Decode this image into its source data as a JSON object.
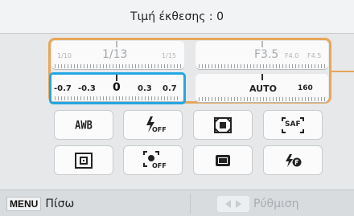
{
  "header": {
    "title": "Τιμή έκθεσης : 0"
  },
  "shutter": {
    "values": [
      "1/10",
      "1/13",
      "1/15"
    ]
  },
  "aperture": {
    "values": [
      "F3.5",
      "F4.0",
      "F4.5"
    ]
  },
  "exposure_compensation": {
    "values": [
      "-0.7",
      "-0.3",
      "0",
      "0.3",
      "0.7"
    ],
    "selected": "0"
  },
  "iso": {
    "values": [
      "AUTO",
      "160"
    ]
  },
  "buttons": [
    {
      "label": "AWB",
      "icon": "white-balance-icon"
    },
    {
      "label": "OFF",
      "icon": "flash-off-icon"
    },
    {
      "label": "",
      "icon": "metering-icon"
    },
    {
      "label": "SAF",
      "icon": "af-mode-icon"
    },
    {
      "label": "",
      "icon": "af-area-icon"
    },
    {
      "label": "OFF",
      "icon": "face-detection-off-icon"
    },
    {
      "label": "",
      "icon": "aspect-ratio-icon"
    },
    {
      "label": "",
      "icon": "flash-f-icon"
    }
  ],
  "footer": {
    "menu_label": "MENU",
    "back_label": "Πίσω",
    "settings_label": "Ρύθμιση"
  },
  "colors": {
    "accent_orange": "#e8a65a",
    "active_blue": "#23a7e3"
  }
}
